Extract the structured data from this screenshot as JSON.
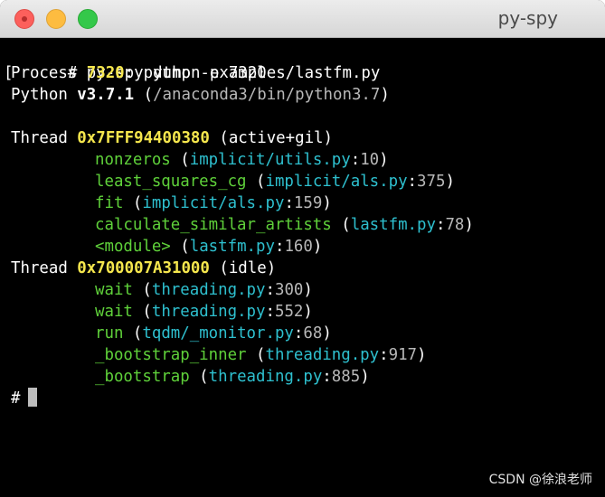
{
  "window": {
    "title": "py-spy"
  },
  "terminal": {
    "cmd_prompt": "# ",
    "command": "py-spy dump -p 7320",
    "process_label": "Process ",
    "pid": "7320",
    "process_colon": ": ",
    "process_cmd": "python examples/lastfm.py",
    "python_label": "Python ",
    "python_version": "v3.7.1",
    "python_path_open": " (",
    "python_path": "/anaconda3/bin/python3.7",
    "python_path_close": ")",
    "threads": [
      {
        "label": "Thread ",
        "id": "0x7FFF94400380",
        "status": " (active+gil)",
        "frames": [
          {
            "func": "nonzeros",
            "file": "implicit/utils.py",
            "line": "10"
          },
          {
            "func": "least_squares_cg",
            "file": "implicit/als.py",
            "line": "375"
          },
          {
            "func": "fit",
            "file": "implicit/als.py",
            "line": "159"
          },
          {
            "func": "calculate_similar_artists",
            "file": "lastfm.py",
            "line": "78"
          },
          {
            "func": "<module>",
            "file": "lastfm.py",
            "line": "160"
          }
        ]
      },
      {
        "label": "Thread ",
        "id": "0x700007A31000",
        "status": " (idle)",
        "frames": [
          {
            "func": "wait",
            "file": "threading.py",
            "line": "300"
          },
          {
            "func": "wait",
            "file": "threading.py",
            "line": "552"
          },
          {
            "func": "run",
            "file": "tqdm/_monitor.py",
            "line": "68"
          },
          {
            "func": "_bootstrap_inner",
            "file": "threading.py",
            "line": "917"
          },
          {
            "func": "_bootstrap",
            "file": "threading.py",
            "line": "885"
          }
        ]
      }
    ],
    "final_prompt": "#",
    "left_bracket": "["
  },
  "watermark": "CSDN @徐浪老师",
  "colors": {
    "background": "#000000",
    "highlight": "#f5e64d",
    "function": "#5fd13a",
    "filename": "#2ec0cf",
    "line_number": "#b8b8b8"
  }
}
